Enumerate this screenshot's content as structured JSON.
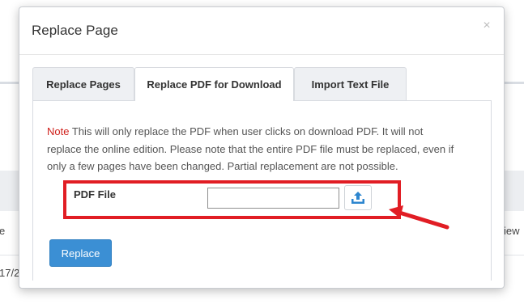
{
  "background": {
    "left_text_1": "e",
    "left_text_2": "17/2",
    "right_text_1": "iew"
  },
  "modal": {
    "title": "Replace Page",
    "close_glyph": "×"
  },
  "tabs": [
    {
      "label": "Replace Pages",
      "active": false
    },
    {
      "label": "Replace PDF for Download",
      "active": true
    },
    {
      "label": "Import Text File",
      "active": false
    }
  ],
  "note": {
    "label": "Note",
    "text": " This will only replace the PDF when user clicks on download PDF. It will not replace the online edition. Please note that the entire PDF file must be replaced, even if only a few pages have been changed. Partial replacement are not possible."
  },
  "form": {
    "pdf_label": "PDF File",
    "file_value": "",
    "upload_icon": "upload-icon"
  },
  "buttons": {
    "replace_label": "Replace"
  },
  "colors": {
    "primary": "#3b8fd4",
    "note_red": "#d0211c",
    "highlight_red": "#e11d24"
  }
}
